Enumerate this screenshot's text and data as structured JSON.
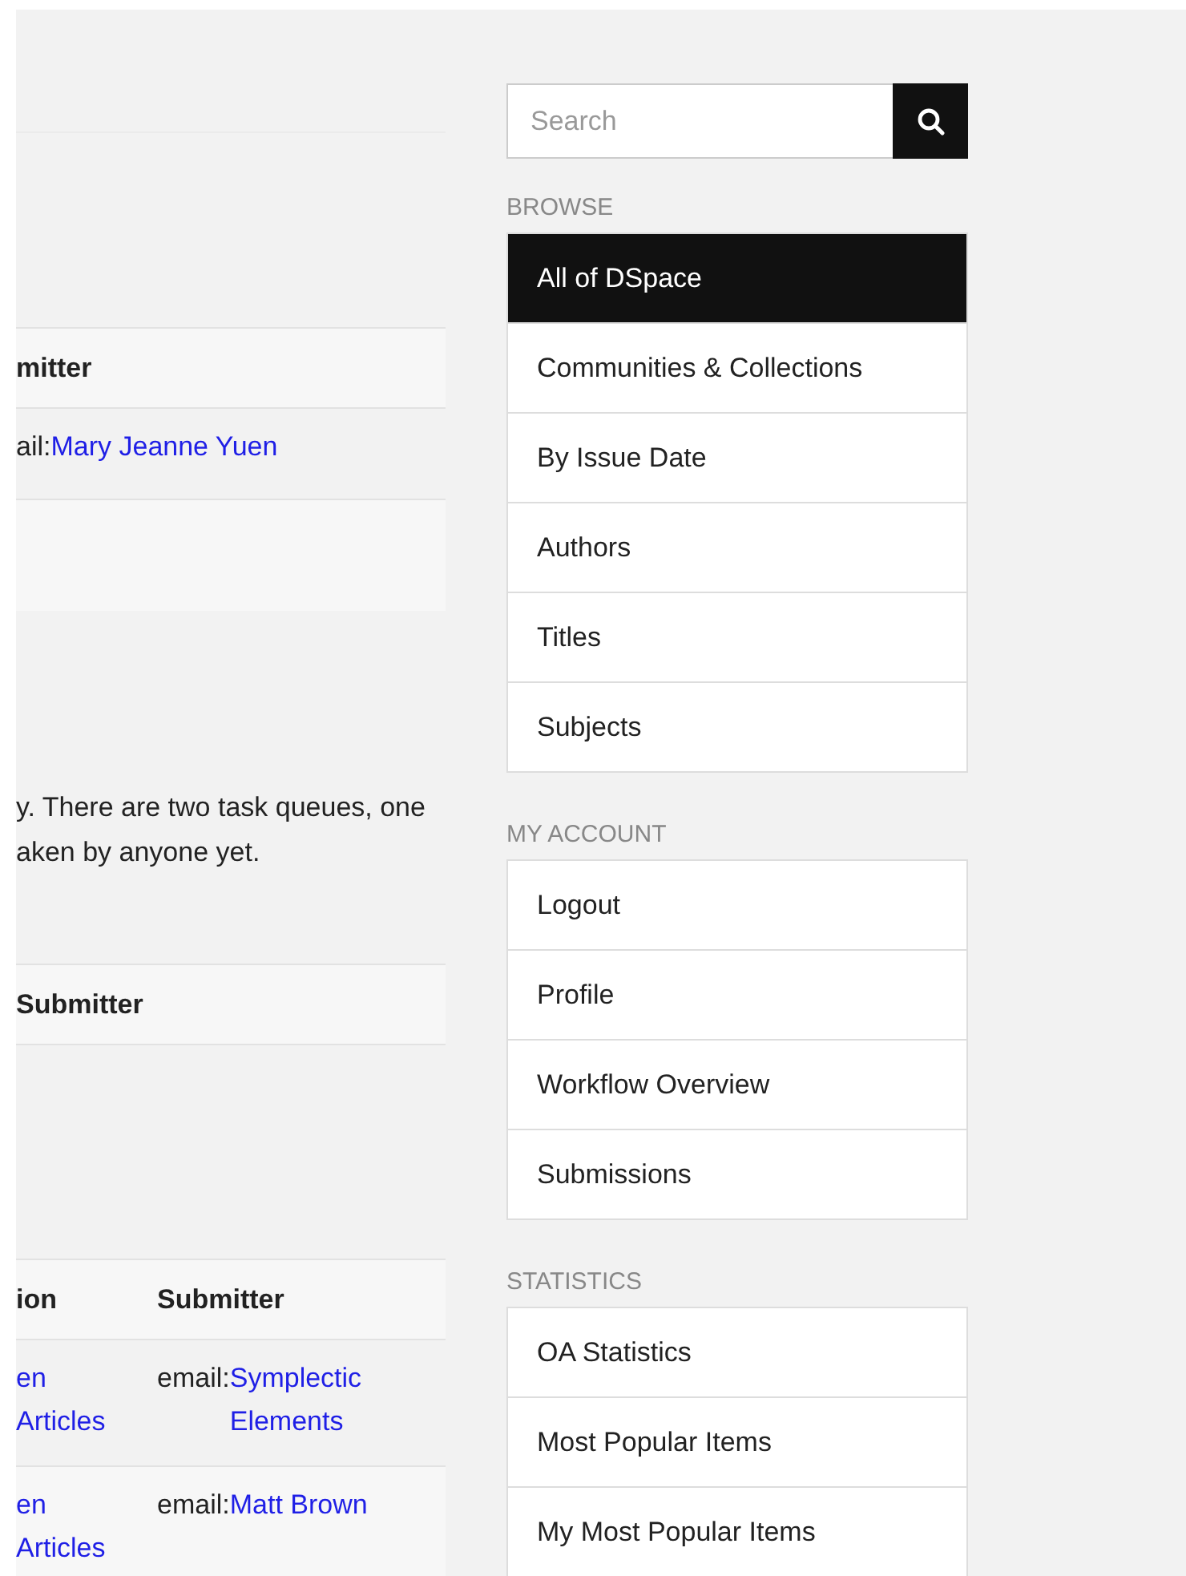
{
  "main": {
    "table_1": {
      "columns": [
        "mitter"
      ],
      "rows": [
        {
          "submitter_prefix": "ail:",
          "submitter_link": "Mary Jeanne Yuen"
        }
      ]
    },
    "intro_lines": [
      "y. There are two task queues, one",
      "aken by anyone yet."
    ],
    "table_2": {
      "columns": [
        "Submitter"
      ]
    },
    "table_3": {
      "columns": [
        "ion",
        "Submitter"
      ],
      "rows": [
        {
          "column_1": "en Articles",
          "submitter_prefix": "email:",
          "submitter_link": "Symplectic Elements"
        },
        {
          "column_1": "en Articles",
          "submitter_prefix": "email:",
          "submitter_link": "Matt Brown"
        }
      ]
    }
  },
  "search": {
    "placeholder": "Search"
  },
  "sidebar": {
    "sections": [
      {
        "heading": "BROWSE",
        "items": [
          {
            "label": "All of DSpace",
            "selected": true
          },
          {
            "label": "Communities & Collections",
            "selected": false
          },
          {
            "label": "By Issue Date",
            "selected": false
          },
          {
            "label": "Authors",
            "selected": false
          },
          {
            "label": "Titles",
            "selected": false
          },
          {
            "label": "Subjects",
            "selected": false
          }
        ]
      },
      {
        "heading": "MY ACCOUNT",
        "items": [
          {
            "label": "Logout",
            "selected": false
          },
          {
            "label": "Profile",
            "selected": false
          },
          {
            "label": "Workflow Overview",
            "selected": false
          },
          {
            "label": "Submissions",
            "selected": false
          }
        ]
      },
      {
        "heading": "STATISTICS",
        "items": [
          {
            "label": "OA Statistics",
            "selected": false
          },
          {
            "label": "Most Popular Items",
            "selected": false
          },
          {
            "label": "My Most Popular Items",
            "selected": false
          }
        ]
      }
    ]
  }
}
